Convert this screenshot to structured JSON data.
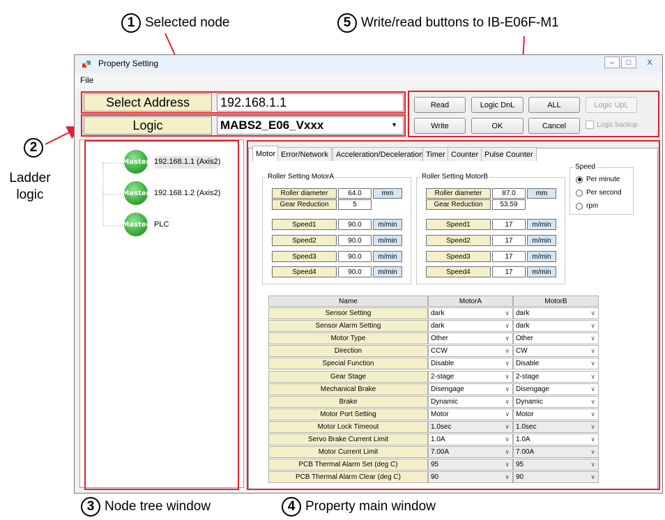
{
  "callouts": {
    "c1": {
      "num": "1",
      "text": "Selected node"
    },
    "c2": {
      "num": "2",
      "text1": "Ladder",
      "text2": "logic"
    },
    "c3": {
      "num": "3",
      "text": "Node tree window"
    },
    "c4": {
      "num": "4",
      "text": "Property main window"
    },
    "c5": {
      "num": "5",
      "text": "Write/read buttons to IB-E06F-M1"
    }
  },
  "window": {
    "title": "Property Setting",
    "menu": [
      "File"
    ],
    "controls": [
      "–",
      "□",
      "X"
    ]
  },
  "header": {
    "select_address_label": "Select Address",
    "select_address_value": "192.168.1.1",
    "logic_label": "Logic",
    "logic_value": "MABS2_E06_Vxxx"
  },
  "buttons": {
    "read": "Read",
    "logic_dnl": "Logic DnL",
    "all": "ALL",
    "logic_upl": "Logic UpL",
    "write": "Write",
    "ok": "OK",
    "cancel": "Cancel",
    "logic_backup": "Logic backup"
  },
  "tree": {
    "badge": "Master",
    "nodes": [
      "192.168.1.1 (Axis2)",
      "192.168.1.2 (Axis2)",
      "PLC"
    ]
  },
  "tabs": [
    "Motor",
    "Error/Network",
    "Acceleration/Deceleration",
    "Timer",
    "Counter",
    "Pulse Counter"
  ],
  "motorA": {
    "title": "Roller Setting MotorA",
    "roller_label": "Roller diameter",
    "roller_value": "64.0",
    "roller_unit": "mm",
    "gear_label": "Gear Reduction",
    "gear_value": "5",
    "speeds": [
      {
        "label": "Speed1",
        "value": "90.0",
        "unit": "m/min"
      },
      {
        "label": "Speed2",
        "value": "90.0",
        "unit": "m/min"
      },
      {
        "label": "Speed3",
        "value": "90.0",
        "unit": "m/min"
      },
      {
        "label": "Speed4",
        "value": "90.0",
        "unit": "m/min"
      }
    ]
  },
  "motorB": {
    "title": "Roller Setting MotorB",
    "roller_label": "Roller diameter",
    "roller_value": "87.0",
    "roller_unit": "mm",
    "gear_label": "Gear Reduction",
    "gear_value": "53.59",
    "speeds": [
      {
        "label": "Speed1",
        "value": "17",
        "unit": "m/min"
      },
      {
        "label": "Speed2",
        "value": "17",
        "unit": "m/min"
      },
      {
        "label": "Speed3",
        "value": "17",
        "unit": "m/min"
      },
      {
        "label": "Speed4",
        "value": "17",
        "unit": "m/min"
      }
    ]
  },
  "speed_group": {
    "title": "Speed",
    "options": [
      "Per minute",
      "Per second",
      "rpm"
    ],
    "selected": "Per minute"
  },
  "table": {
    "headers": [
      "Name",
      "MotorA",
      "MotorB"
    ],
    "rows": [
      {
        "name": "Sensor Setting",
        "a": "dark",
        "b": "dark"
      },
      {
        "name": "Sensor Alarm Setting",
        "a": "dark",
        "b": "dark"
      },
      {
        "name": "Motor Type",
        "a": "Other",
        "b": "Other"
      },
      {
        "name": "Direction",
        "a": "CCW",
        "b": "CW"
      },
      {
        "name": "Special Function",
        "a": "Disable",
        "b": "Disable"
      },
      {
        "name": "Gear Stage",
        "a": "2-stage",
        "b": "2-stage"
      },
      {
        "name": "Mechanical Brake",
        "a": "Disengage",
        "b": "Disengage"
      },
      {
        "name": "Brake",
        "a": "Dynamic",
        "b": "Dynamic"
      },
      {
        "name": "Motor Port Setting",
        "a": "Motor",
        "b": "Motor"
      },
      {
        "name": "Motor Lock Timeout",
        "a": "1.0sec",
        "b": "1.0sec"
      },
      {
        "name": "Servo Brake Current Limit",
        "a": "1.0A",
        "b": "1.0A"
      },
      {
        "name": "Motor Current Limit",
        "a": "7.00A",
        "b": "7.00A"
      },
      {
        "name": "PCB Thermal Alarm Set (deg C)",
        "a": "95",
        "b": "95"
      },
      {
        "name": "PCB Thermal Alarm Clear (deg C)",
        "a": "90",
        "b": "90"
      }
    ],
    "grey_rows": [
      9,
      11,
      12,
      13
    ]
  },
  "colors": {
    "callout_red": "#e0202a",
    "label_yellow": "#f3f0c9",
    "unit_blue": "#d4e6f4",
    "master_green": "#2fa22f"
  }
}
